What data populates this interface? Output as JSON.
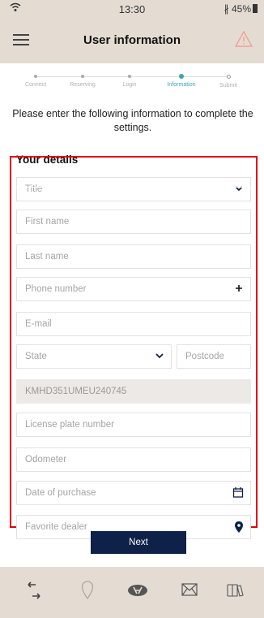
{
  "status_bar": {
    "time": "13:30",
    "battery": "45%"
  },
  "header": {
    "title": "User information"
  },
  "stepper": {
    "steps": [
      {
        "label": "Connect",
        "state": "done"
      },
      {
        "label": "Reserving",
        "state": "done"
      },
      {
        "label": "Login",
        "state": "done"
      },
      {
        "label": "Information",
        "state": "active"
      },
      {
        "label": "Submit",
        "state": "todo"
      }
    ]
  },
  "intro": "Please enter the following information to complete the settings.",
  "section_title": "Your details",
  "form": {
    "title_placeholder": "Title",
    "first_name_placeholder": "First name",
    "last_name_placeholder": "Last name",
    "phone_placeholder": "Phone number",
    "email_placeholder": "E-mail",
    "state_placeholder": "State",
    "postcode_placeholder": "Postcode",
    "vin_value": "KMHD351UMEU240745",
    "license_placeholder": "License plate number",
    "odometer_placeholder": "Odometer",
    "purchase_date_placeholder": "Date of purchase",
    "dealer_placeholder": "Favorite dealer"
  },
  "next_button": "Next",
  "colors": {
    "header_bg": "#e4dcd3",
    "accent": "#3aa5b5",
    "button_bg": "#0e2148",
    "highlight_border": "#e3000f",
    "warning": "#f0a09a"
  },
  "bottom_nav": {
    "icons": [
      "connect-icon",
      "location-icon",
      "hyundai-logo-icon",
      "mail-icon",
      "book-icon"
    ]
  }
}
